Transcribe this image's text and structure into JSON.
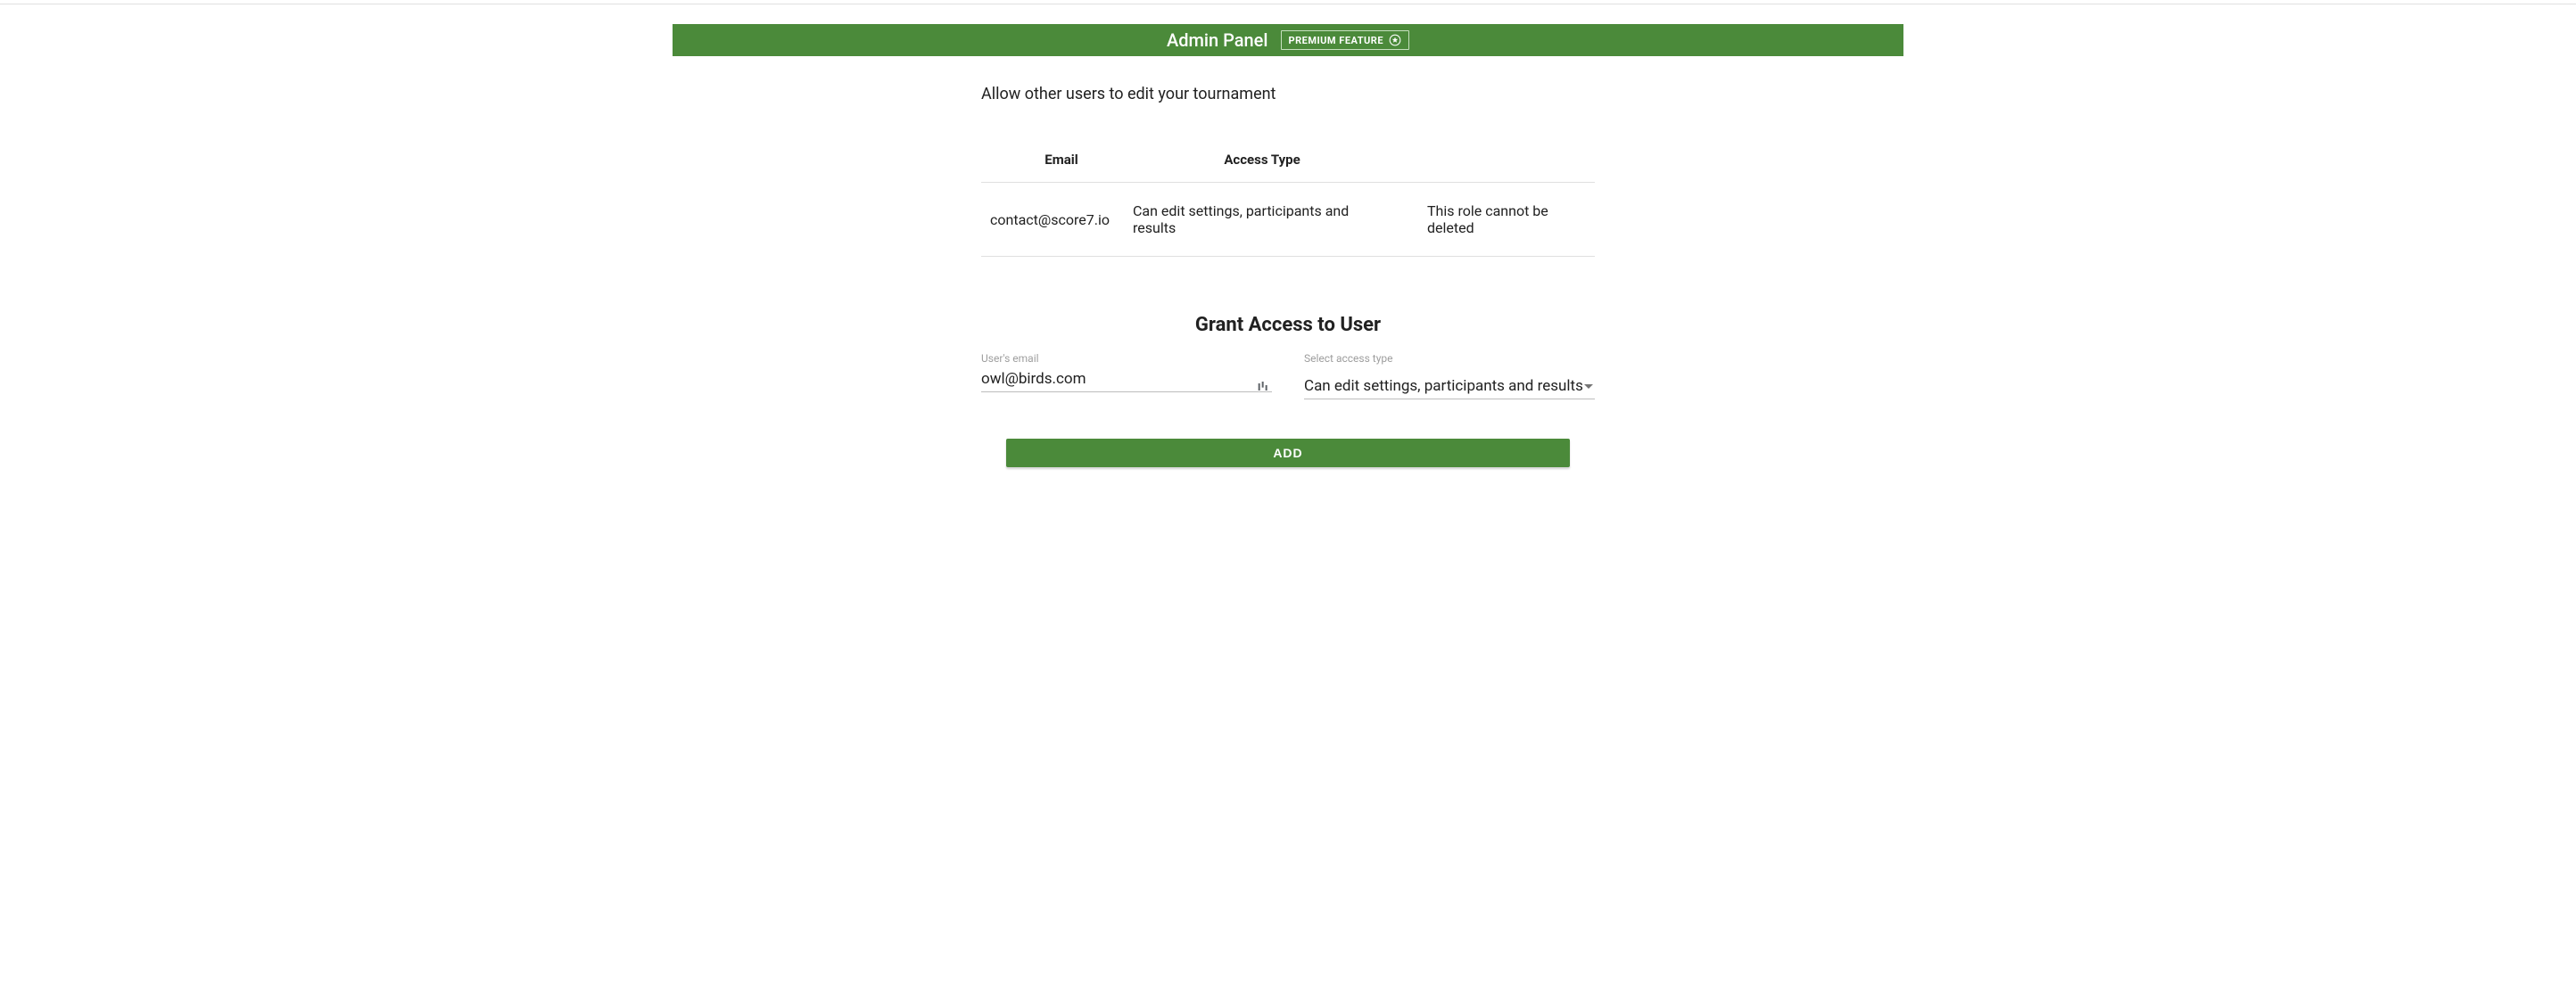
{
  "header": {
    "title": "Admin Panel",
    "premium_label": "PREMIUM FEATURE"
  },
  "intro": "Allow other users to edit your tournament",
  "table": {
    "headers": {
      "email": "Email",
      "access_type": "Access Type"
    },
    "rows": [
      {
        "email": "contact@score7.io",
        "access_type": "Can edit settings, participants and results",
        "note": "This role cannot be deleted"
      }
    ]
  },
  "grant": {
    "title": "Grant Access to User",
    "email_label": "User's email",
    "email_value": "owl@birds.com",
    "access_label": "Select access type",
    "access_value": "Can edit settings, participants and results"
  },
  "actions": {
    "add_label": "ADD"
  },
  "colors": {
    "brand": "#4b8a3a"
  }
}
